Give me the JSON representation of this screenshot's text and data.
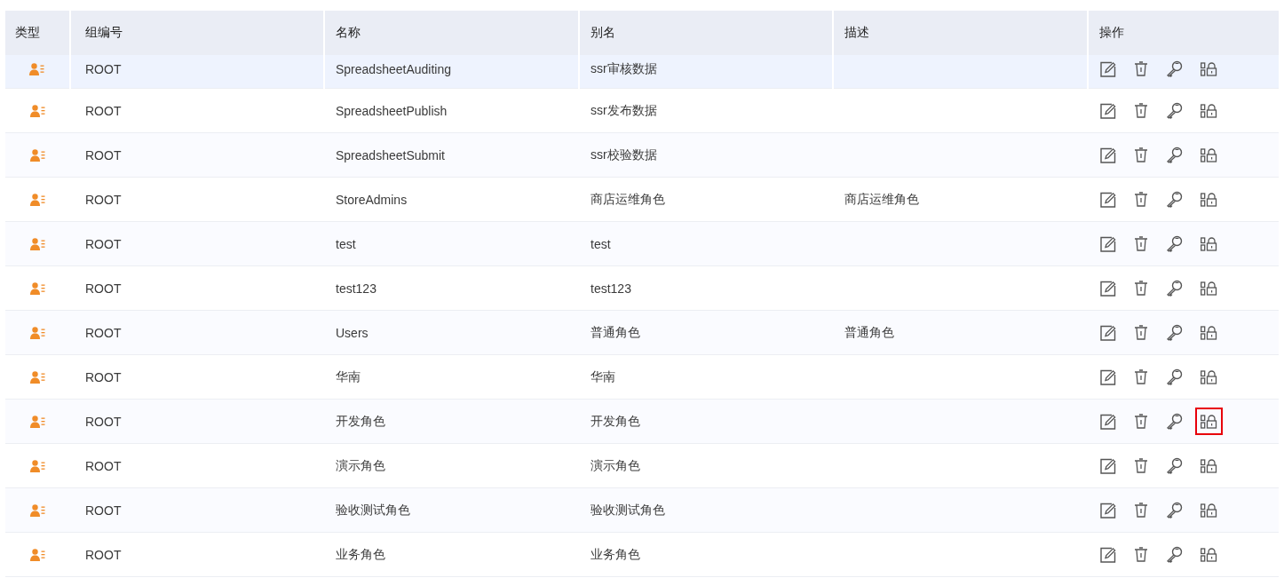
{
  "table": {
    "columns": [
      "类型",
      "组编号",
      "名称",
      "别名",
      "描述",
      "操作"
    ],
    "rows": [
      {
        "group": "ROOT",
        "name": "SpreadsheetAuditing",
        "alias": "ssr审核数据",
        "description": "",
        "selected": true,
        "lock_highlighted": false
      },
      {
        "group": "ROOT",
        "name": "SpreadsheetPublish",
        "alias": "ssr发布数据",
        "description": "",
        "selected": false,
        "lock_highlighted": false
      },
      {
        "group": "ROOT",
        "name": "SpreadsheetSubmit",
        "alias": "ssr校验数据",
        "description": "",
        "selected": false,
        "lock_highlighted": false
      },
      {
        "group": "ROOT",
        "name": "StoreAdmins",
        "alias": "商店运维角色",
        "description": "商店运维角色",
        "selected": false,
        "lock_highlighted": false
      },
      {
        "group": "ROOT",
        "name": "test",
        "alias": "test",
        "description": "",
        "selected": false,
        "lock_highlighted": false
      },
      {
        "group": "ROOT",
        "name": "test123",
        "alias": "test123",
        "description": "",
        "selected": false,
        "lock_highlighted": false
      },
      {
        "group": "ROOT",
        "name": "Users",
        "alias": "普通角色",
        "description": "普通角色",
        "selected": false,
        "lock_highlighted": false
      },
      {
        "group": "ROOT",
        "name": "华南",
        "alias": "华南",
        "description": "",
        "selected": false,
        "lock_highlighted": false
      },
      {
        "group": "ROOT",
        "name": "开发角色",
        "alias": "开发角色",
        "description": "",
        "selected": false,
        "lock_highlighted": true
      },
      {
        "group": "ROOT",
        "name": "演示角色",
        "alias": "演示角色",
        "description": "",
        "selected": false,
        "lock_highlighted": false
      },
      {
        "group": "ROOT",
        "name": "验收测试角色",
        "alias": "验收测试角色",
        "description": "",
        "selected": false,
        "lock_highlighted": false
      },
      {
        "group": "ROOT",
        "name": "业务角色",
        "alias": "业务角色",
        "description": "",
        "selected": false,
        "lock_highlighted": false
      }
    ]
  }
}
